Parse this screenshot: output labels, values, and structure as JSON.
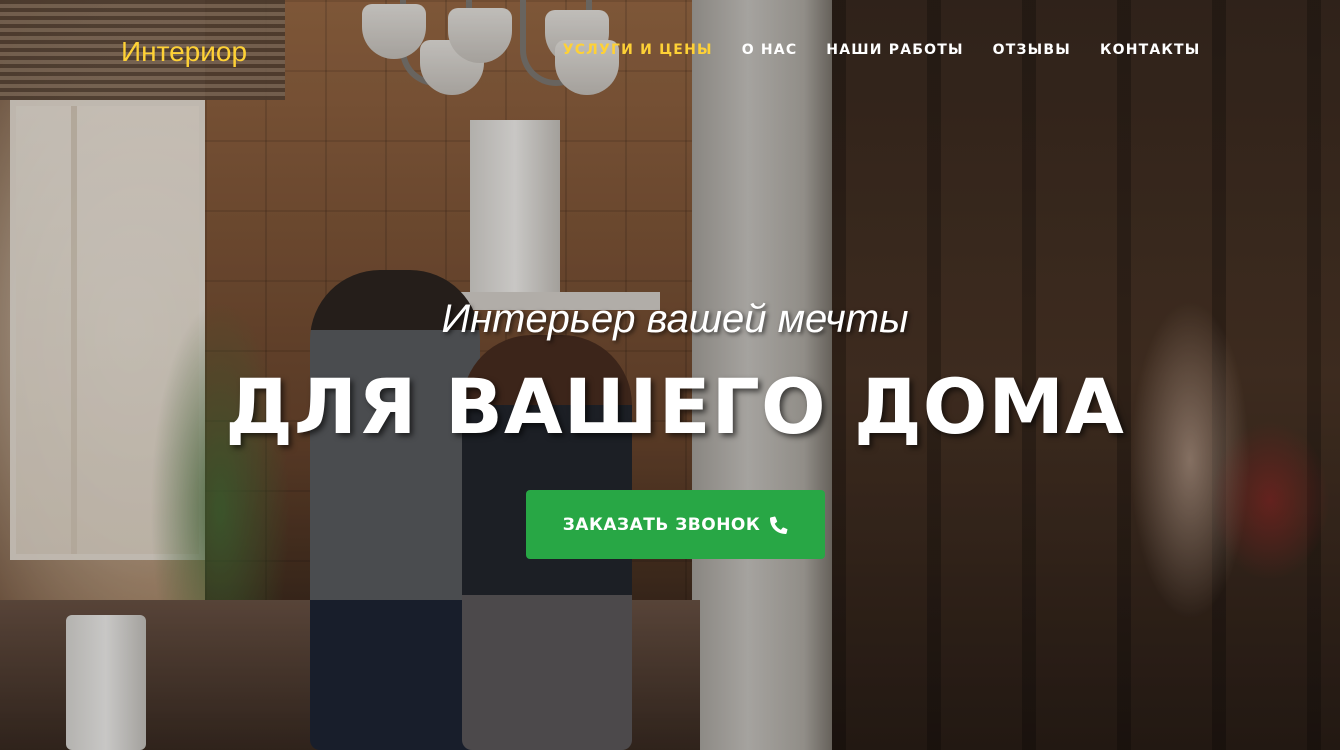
{
  "brand": {
    "name": "Интериор",
    "color": "#fed136"
  },
  "nav": {
    "items": [
      {
        "label": "УСЛУГИ И ЦЕНЫ",
        "active": true
      },
      {
        "label": "О НАС",
        "active": false
      },
      {
        "label": "НАШИ РАБОТЫ",
        "active": false
      },
      {
        "label": "ОТЗЫВЫ",
        "active": false
      },
      {
        "label": "КОНТАКТЫ",
        "active": false
      }
    ],
    "active_color": "#fed136",
    "text_color": "#ffffff"
  },
  "hero": {
    "subtitle": "Интерьер вашей мечты",
    "title": "ДЛЯ ВАШЕГО ДОМА",
    "cta": {
      "label": "ЗАКАЗАТЬ ЗВОНОК",
      "icon": "phone-icon",
      "color": "#28a745"
    },
    "background": "kitchen-photo-couple-cooking"
  }
}
